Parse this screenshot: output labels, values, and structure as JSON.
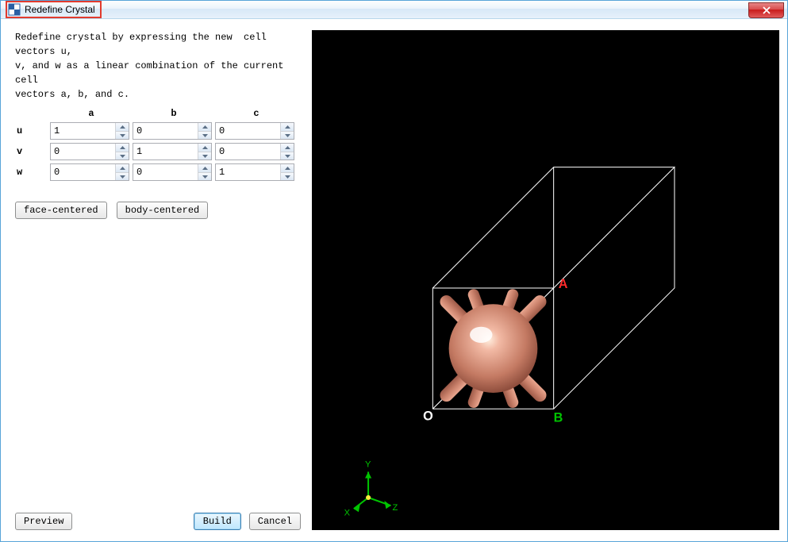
{
  "window": {
    "title": "Redefine Crystal"
  },
  "instructions": "Redefine crystal by expressing the new  cell vectors u,\nv, and w as a linear combination of the current cell\nvectors a, b, and c.",
  "headers": {
    "a": "a",
    "b": "b",
    "c": "c"
  },
  "rows": {
    "u": {
      "label": "u",
      "a": "1",
      "b": "0",
      "c": "0"
    },
    "v": {
      "label": "v",
      "a": "0",
      "b": "1",
      "c": "0"
    },
    "w": {
      "label": "w",
      "a": "0",
      "b": "0",
      "c": "1"
    }
  },
  "buttons": {
    "face_centered": "face-centered",
    "body_centered": "body-centered",
    "preview": "Preview",
    "build": "Build",
    "cancel": "Cancel"
  },
  "viewport": {
    "origin_label": "O",
    "b_label": "B",
    "a_label": "A",
    "triad": {
      "x": "X",
      "y": "Y",
      "z": "Z"
    }
  },
  "colors": {
    "atom": "#d08068",
    "atom_hi": "#f5d0c2",
    "cell_edge": "#ffffff",
    "bg": "#000000"
  }
}
